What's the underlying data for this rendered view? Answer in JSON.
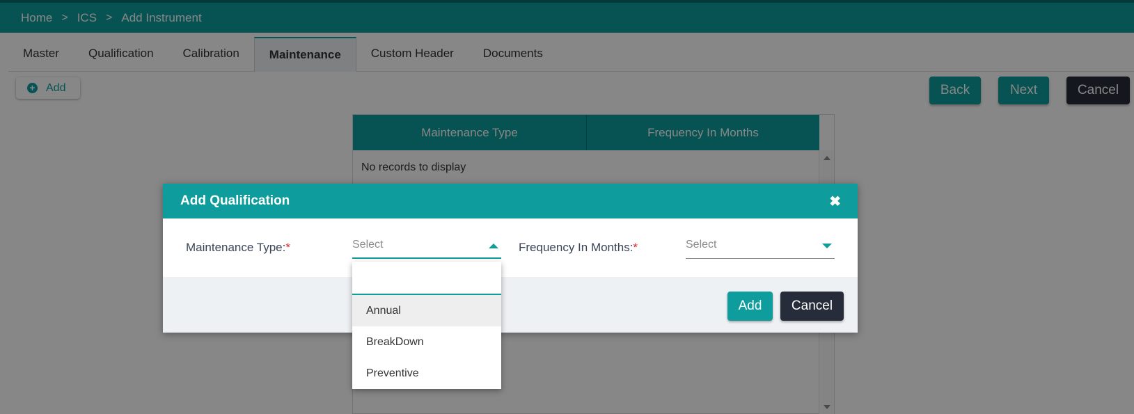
{
  "breadcrumb": {
    "home": "Home",
    "module": "ICS",
    "page": "Add Instrument",
    "separator": ">"
  },
  "tabs": [
    {
      "label": "Master"
    },
    {
      "label": "Qualification"
    },
    {
      "label": "Calibration"
    },
    {
      "label": "Maintenance",
      "active": true
    },
    {
      "label": "Custom Header"
    },
    {
      "label": "Documents"
    }
  ],
  "toolbar": {
    "add_label": "Add",
    "back_label": "Back",
    "next_label": "Next",
    "cancel_label": "Cancel"
  },
  "grid": {
    "columns": [
      "Maintenance Type",
      "Frequency In Months"
    ],
    "empty_message": "No records to display"
  },
  "dialog": {
    "title": "Add Qualification",
    "close_glyph": "✖",
    "maintenance_type": {
      "label": "Maintenance Type:",
      "required": "*",
      "placeholder": "Select"
    },
    "frequency": {
      "label": "Frequency In Months:",
      "required": "*",
      "placeholder": "Select"
    },
    "add_label": "Add",
    "cancel_label": "Cancel"
  },
  "dropdown": {
    "search_value": "",
    "options": [
      "Annual",
      "BreakDown",
      "Preventive"
    ],
    "highlighted": "Annual"
  },
  "colors": {
    "accent": "#0e9c9c",
    "dark_button": "#262c3a",
    "required": "#e0262e"
  }
}
